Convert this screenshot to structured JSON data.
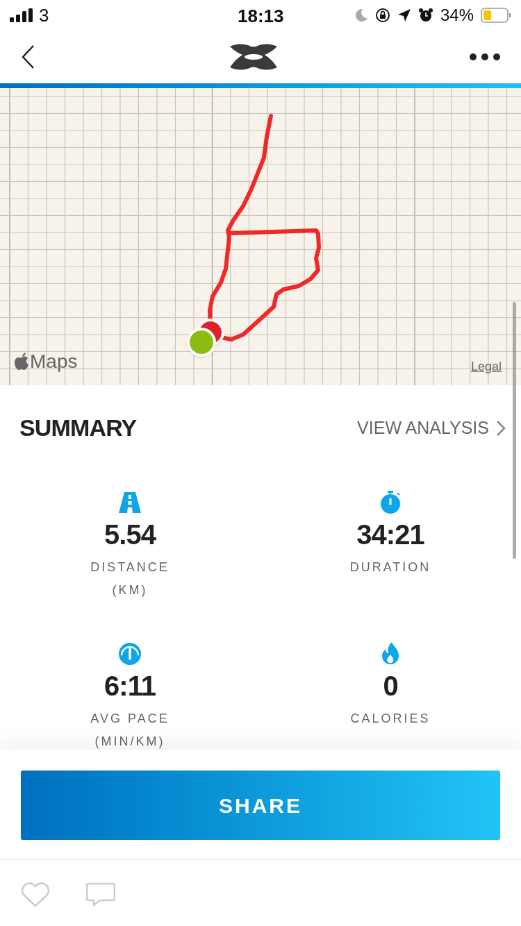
{
  "status_bar": {
    "carrier": "3",
    "time": "18:13",
    "battery": "34%"
  },
  "map": {
    "maps_label": "Maps",
    "legal_link": "Legal"
  },
  "summary": {
    "title": "SUMMARY",
    "link": "VIEW ANALYSIS"
  },
  "stats": [
    {
      "kind": "distance",
      "value": "5.54",
      "label": "DISTANCE",
      "unit": "(KM)"
    },
    {
      "kind": "duration",
      "value": "34:21",
      "label": "DURATION"
    },
    {
      "kind": "pace",
      "value": "6:11",
      "label": "AVG PACE",
      "unit": "(MIN/KM)"
    },
    {
      "kind": "calories",
      "value": "0",
      "label": "CALORIES"
    }
  ],
  "share_button": "SHARE"
}
